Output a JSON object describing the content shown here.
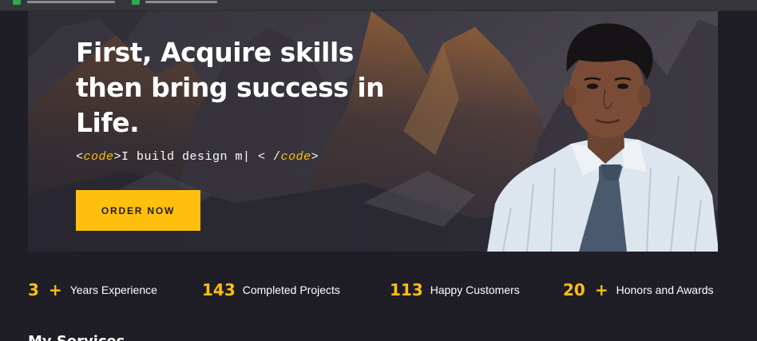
{
  "hero": {
    "title": "First, Acquire skills then bring success in Life.",
    "code_open_bracket": "<",
    "code_open_tag": "code",
    "code_text": ">I build design m| < /",
    "code_close_tag": "code",
    "code_close_bracket": ">",
    "button_label": "ORDER NOW"
  },
  "stats": [
    {
      "number": "3",
      "plus": "+",
      "label": "Years Experience"
    },
    {
      "number": "143",
      "plus": "",
      "label": "Completed Projects"
    },
    {
      "number": "113",
      "plus": "",
      "label": "Happy Customers"
    },
    {
      "number": "20",
      "plus": "+",
      "label": "Honors and Awards"
    }
  ],
  "next_section": {
    "heading": "My Services"
  },
  "colors": {
    "accent": "#ffbf0f",
    "background": "#1f1e27",
    "bookmark_icon": "#2fa84f"
  },
  "icons": [
    "spreadsheet-bookmark-icon",
    "sheets-bookmark-icon"
  ]
}
